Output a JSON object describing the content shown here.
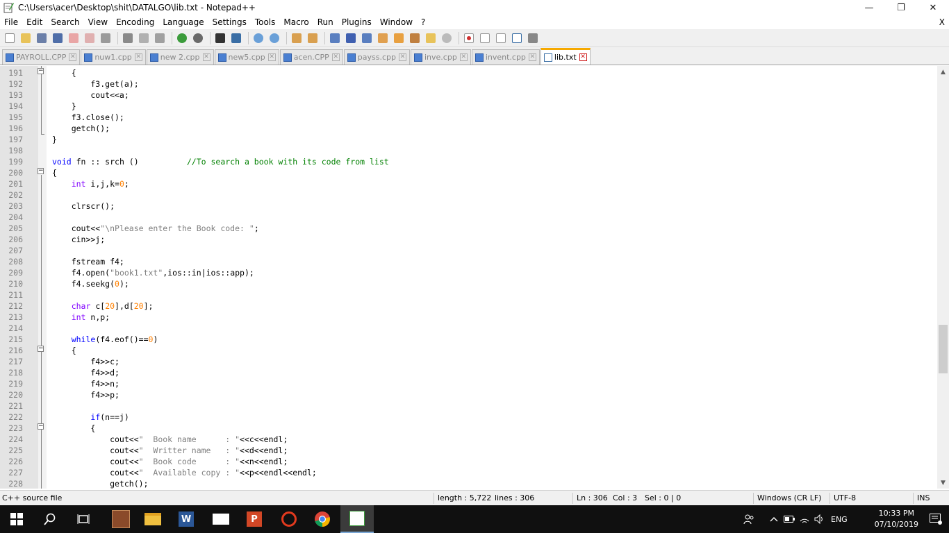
{
  "window": {
    "title": "C:\\Users\\acer\\Desktop\\shit\\DATALGO\\lib.txt - Notepad++",
    "minimize": "—",
    "maximize": "❐",
    "close": "✕"
  },
  "menu": {
    "items": [
      "File",
      "Edit",
      "Search",
      "View",
      "Encoding",
      "Language",
      "Settings",
      "Tools",
      "Macro",
      "Run",
      "Plugins",
      "Window",
      "?"
    ],
    "close": "X"
  },
  "tabs": [
    {
      "label": "PAYROLL.CPP",
      "active": false
    },
    {
      "label": "nuw1.cpp",
      "active": false
    },
    {
      "label": "new 2.cpp",
      "active": false
    },
    {
      "label": "new5.cpp",
      "active": false
    },
    {
      "label": "acen.CPP",
      "active": false
    },
    {
      "label": "payss.cpp",
      "active": false
    },
    {
      "label": "inve.cpp",
      "active": false
    },
    {
      "label": "invent.cpp",
      "active": false
    },
    {
      "label": "lib.txt",
      "active": true
    }
  ],
  "editor": {
    "lines": [
      {
        "n": "191",
        "code": "    {"
      },
      {
        "n": "192",
        "code": "        f3.get(a);"
      },
      {
        "n": "193",
        "code": "        cout<<a;"
      },
      {
        "n": "194",
        "code": "    }"
      },
      {
        "n": "195",
        "code": "    f3.close();"
      },
      {
        "n": "196",
        "code": "    getch();"
      },
      {
        "n": "197",
        "code": "}"
      },
      {
        "n": "198",
        "code": ""
      },
      {
        "n": "199",
        "code": "void fn :: srch ()          //To search a book with its code from list"
      },
      {
        "n": "200",
        "code": "{"
      },
      {
        "n": "201",
        "code": "    int i,j,k=0;"
      },
      {
        "n": "202",
        "code": ""
      },
      {
        "n": "203",
        "code": "    clrscr();"
      },
      {
        "n": "204",
        "code": ""
      },
      {
        "n": "205",
        "code": "    cout<<\"\\nPlease enter the Book code: \";"
      },
      {
        "n": "206",
        "code": "    cin>>j;"
      },
      {
        "n": "207",
        "code": ""
      },
      {
        "n": "208",
        "code": "    fstream f4;"
      },
      {
        "n": "209",
        "code": "    f4.open(\"book1.txt\",ios::in|ios::app);"
      },
      {
        "n": "210",
        "code": "    f4.seekg(0);"
      },
      {
        "n": "211",
        "code": ""
      },
      {
        "n": "212",
        "code": "    char c[20],d[20];"
      },
      {
        "n": "213",
        "code": "    int n,p;"
      },
      {
        "n": "214",
        "code": ""
      },
      {
        "n": "215",
        "code": "    while(f4.eof()==0)"
      },
      {
        "n": "216",
        "code": "    {"
      },
      {
        "n": "217",
        "code": "        f4>>c;"
      },
      {
        "n": "218",
        "code": "        f4>>d;"
      },
      {
        "n": "219",
        "code": "        f4>>n;"
      },
      {
        "n": "220",
        "code": "        f4>>p;"
      },
      {
        "n": "221",
        "code": ""
      },
      {
        "n": "222",
        "code": "        if(n==j)"
      },
      {
        "n": "223",
        "code": "        {"
      },
      {
        "n": "224",
        "code": "            cout<<\"  Book name      : \"<<c<<endl;"
      },
      {
        "n": "225",
        "code": "            cout<<\"  Writter name   : \"<<d<<endl;"
      },
      {
        "n": "226",
        "code": "            cout<<\"  Book code      : \"<<n<<endl;"
      },
      {
        "n": "227",
        "code": "            cout<<\"  Available copy : \"<<p<<endl<<endl;"
      },
      {
        "n": "228",
        "code": "            getch();"
      }
    ]
  },
  "status": {
    "file_type": "C++ source file",
    "length": "length : 5,722",
    "lines": "lines : 306",
    "ln": "Ln : 306",
    "col": "Col : 3",
    "sel": "Sel : 0 | 0",
    "eol": "Windows (CR LF)",
    "encoding": "UTF-8",
    "mode": "INS"
  },
  "taskbar": {
    "language": "ENG",
    "time": "10:33 PM",
    "date": "07/10/2019"
  }
}
